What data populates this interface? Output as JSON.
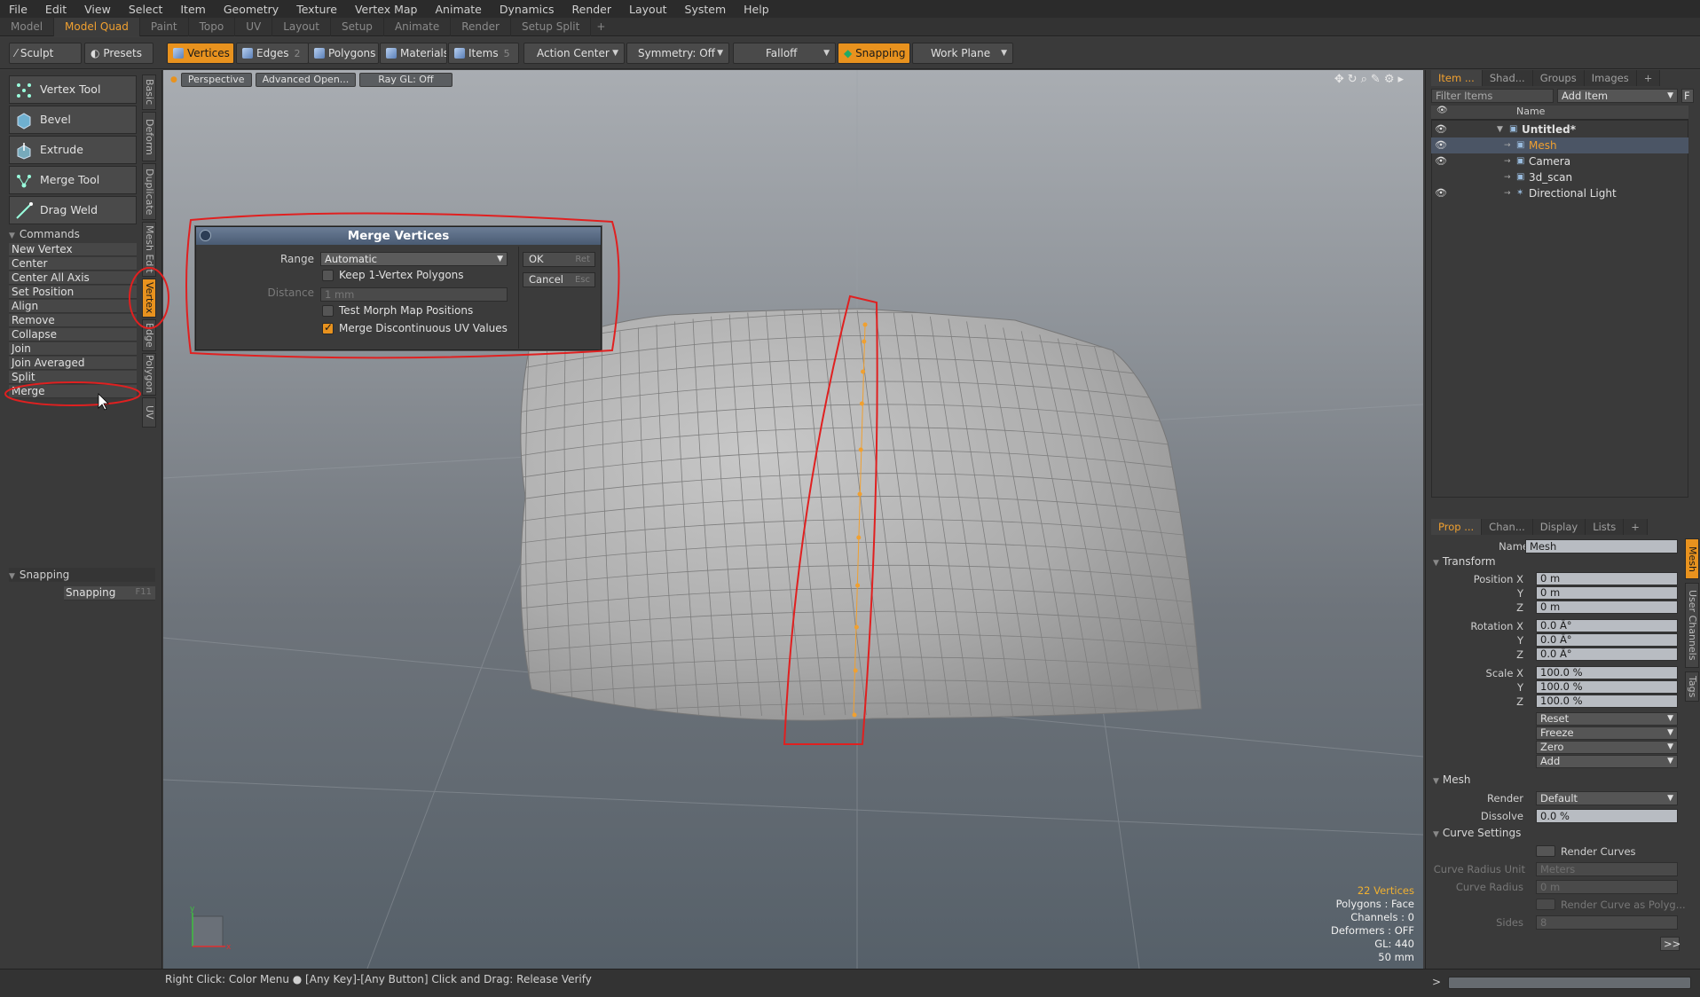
{
  "menu": [
    "File",
    "Edit",
    "View",
    "Select",
    "Item",
    "Geometry",
    "Texture",
    "Vertex Map",
    "Animate",
    "Dynamics",
    "Render",
    "Layout",
    "System",
    "Help"
  ],
  "layout_tabs": [
    "Model",
    "Model Quad",
    "Paint",
    "Topo",
    "UV",
    "Layout",
    "Setup",
    "Animate",
    "Render",
    "Setup Split"
  ],
  "layout_tab_active": "Model Quad",
  "toolbar": {
    "sculpt": "Sculpt",
    "presets": "Presets",
    "vertices": "Vertices",
    "edges": "Edges",
    "edges_count": "2",
    "polygons": "Polygons",
    "materials": "Materials",
    "items": "Items",
    "items_count": "5",
    "action_center": "Action Center",
    "symmetry": "Symmetry: Off",
    "falloff": "Falloff",
    "snapping": "Snapping",
    "work_plane": "Work Plane"
  },
  "tools": [
    "Vertex Tool",
    "Bevel",
    "Extrude",
    "Merge Tool",
    "Drag Weld"
  ],
  "commands_header": "Commands",
  "commands": [
    "New Vertex",
    "Center",
    "Center All Axis",
    "Set Position",
    "Align",
    "Remove",
    "Collapse",
    "Join",
    "Join Averaged",
    "Split",
    "Merge"
  ],
  "snapping_header": "Snapping",
  "snapping_button": "Snapping",
  "snapping_key": "F11",
  "vertical_tabs": [
    "Basic",
    "Deform",
    "Duplicate",
    "Mesh Edit",
    "Vertex",
    "Edge",
    "Polygon",
    "UV"
  ],
  "vertical_tab_active": "Vertex",
  "viewport": {
    "perspective": "Perspective",
    "advanced": "Advanced Open...",
    "raygl": "Ray GL: Off",
    "stats": {
      "vertices": "22 Vertices",
      "polygons": "Polygons : Face",
      "channels": "Channels : 0",
      "deformers": "Deformers : OFF",
      "gl": "GL: 440",
      "scale": "50 mm"
    }
  },
  "dialog": {
    "title": "Merge Vertices",
    "range_label": "Range",
    "range_value": "Automatic",
    "keep_label": "Keep 1-Vertex Polygons",
    "distance_label": "Distance",
    "distance_value": "1 mm",
    "test_label": "Test Morph Map Positions",
    "merge_uv_label": "Merge Discontinuous UV Values",
    "merge_uv_checked": true,
    "ok": "OK",
    "ok_key": "Ret",
    "cancel": "Cancel",
    "cancel_key": "Esc"
  },
  "items_panel": {
    "tabs": [
      "Item ...",
      "Shad...",
      "Groups",
      "Images"
    ],
    "filter": "Filter Items",
    "add_item": "Add Item",
    "column_name": "Name",
    "tree": [
      {
        "name": "Untitled*",
        "bold": true
      },
      {
        "name": "Mesh",
        "selected": true
      },
      {
        "name": "Camera"
      },
      {
        "name": "3d_scan"
      },
      {
        "name": "Directional Light"
      }
    ]
  },
  "props_panel": {
    "tabs": [
      "Prop ...",
      "Chan...",
      "Display",
      "Lists"
    ],
    "side_tabs": [
      "Mesh",
      "User Channels",
      "Tags"
    ],
    "name_label": "Name",
    "name_value": "Mesh",
    "transform_header": "Transform",
    "position_label": "Position X",
    "rotation_label": "Rotation X",
    "scale_label": "Scale X",
    "y": "Y",
    "z": "Z",
    "position": [
      "0 m",
      "0 m",
      "0 m"
    ],
    "rotation": [
      "0.0 Â°",
      "0.0 Â°",
      "0.0 Â°"
    ],
    "scale": [
      "100.0 %",
      "100.0 %",
      "100.0 %"
    ],
    "actions": [
      "Reset",
      "Freeze",
      "Zero",
      "Add"
    ],
    "mesh_header": "Mesh",
    "render_label": "Render",
    "render_value": "Default",
    "dissolve_label": "Dissolve",
    "dissolve_value": "0.0 %",
    "curve_header": "Curve Settings",
    "render_curves": "Render Curves",
    "curve_radius_unit_label": "Curve Radius Unit",
    "curve_radius_unit_value": "Meters",
    "curve_radius_label": "Curve Radius",
    "curve_radius_value": "0 m",
    "render_curve_poly": "Render Curve as Polyg...",
    "sides_label": "Sides",
    "sides_value": "8",
    "more": ">>"
  },
  "statusbar": "Right Click: Color Menu ●  [Any Key]-[Any Button] Click and Drag: Release Verify",
  "cmdline_prompt": ">"
}
